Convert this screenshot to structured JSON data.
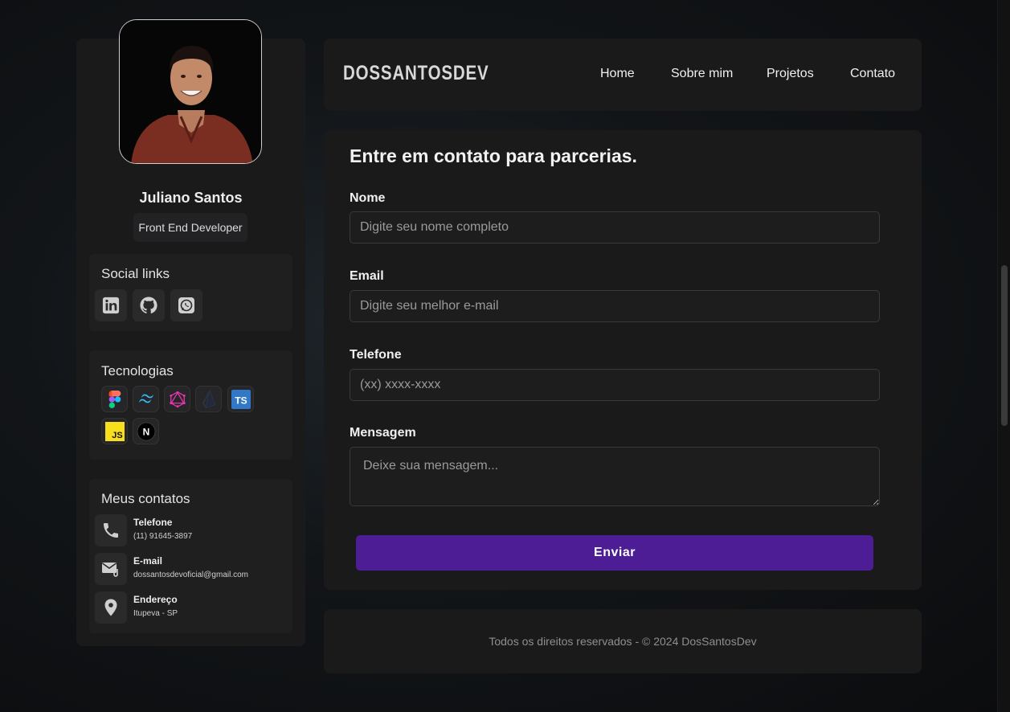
{
  "profile": {
    "name": "Juliano Santos",
    "role": "Front End Developer"
  },
  "social": {
    "title": "Social links",
    "links": [
      {
        "icon": "linkedin-icon"
      },
      {
        "icon": "github-icon"
      },
      {
        "icon": "whatsapp-icon"
      }
    ]
  },
  "tech": {
    "title": "Tecnologias",
    "items": [
      {
        "icon": "figma-icon"
      },
      {
        "icon": "tailwind-icon"
      },
      {
        "icon": "graphql-icon"
      },
      {
        "icon": "prisma-icon"
      },
      {
        "icon": "typescript-icon",
        "text": "TS"
      },
      {
        "icon": "javascript-icon",
        "text": "JS"
      },
      {
        "icon": "nextjs-icon",
        "text": "N"
      }
    ]
  },
  "contacts": {
    "title": "Meus contatos",
    "items": [
      {
        "label": "Telefone",
        "value": "(11) 91645-3897",
        "icon": "phone-icon"
      },
      {
        "label": "E-mail",
        "value": "dossantosdevoficial@gmail.com",
        "icon": "mail-icon"
      },
      {
        "label": "Endereço",
        "value": "Itupeva - SP",
        "icon": "location-icon"
      }
    ]
  },
  "header": {
    "logo": "DOSSANTOSDEV",
    "nav": [
      "Home",
      "Sobre mim",
      "Projetos",
      "Contato"
    ]
  },
  "form": {
    "title": "Entre em contato para parcerias.",
    "fields": [
      {
        "label": "Nome",
        "placeholder": "Digite seu nome completo"
      },
      {
        "label": "Email",
        "placeholder": "Digite seu melhor e-mail"
      },
      {
        "label": "Telefone",
        "placeholder": "(xx) xxxx-xxxx"
      },
      {
        "label": "Mensagem",
        "placeholder": "Deixe sua mensagem..."
      }
    ],
    "submit": "Enviar"
  },
  "footer": {
    "text": "Todos os direitos reservados - © 2024 DosSantosDev"
  },
  "colors": {
    "accent": "#4c1d95",
    "card": "#1a1a1b",
    "typescript": "#3178c6",
    "javascript": "#f7df1e"
  }
}
